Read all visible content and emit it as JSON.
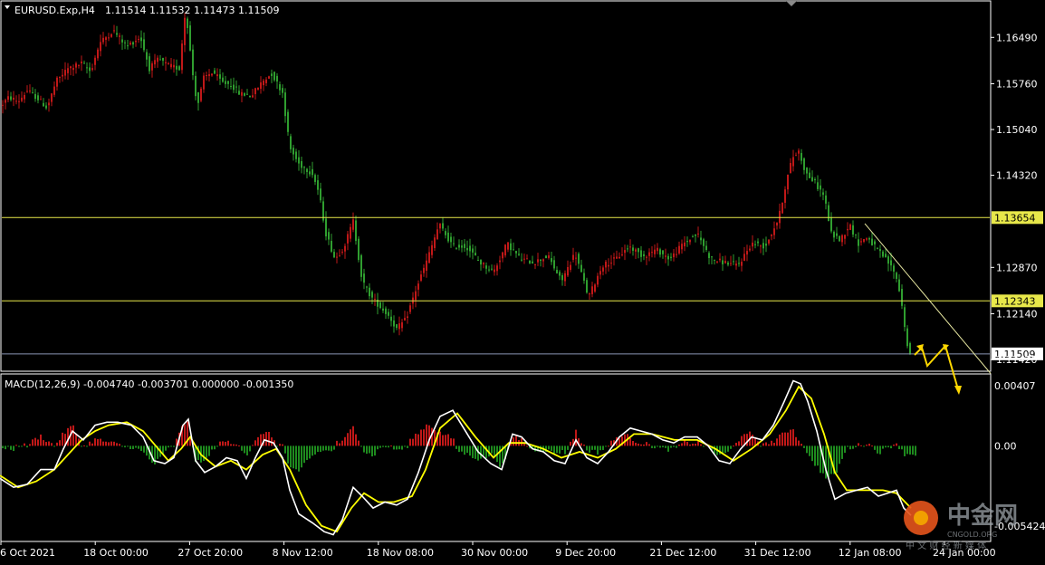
{
  "header": {
    "symbol": "EURUSD.Exp,H4",
    "ohlc": "1.11514 1.11532 1.11473 1.11509"
  },
  "macd": {
    "label": "MACD(12,26,9) -0.004740 -0.003701 0.000000 -0.001350"
  },
  "watermark": {
    "brand": "中金网",
    "sub": "CNGOLD.ORG",
    "tagline": "中 文 财 经 新 媒 体"
  },
  "colors": {
    "background": "#000000",
    "bull_candle": "#c01818",
    "bear_candle": "#2f9e2f",
    "level_line": "#e8e84a",
    "bid_line": "#8a96b4",
    "macd_line": "#ffffff",
    "signal_line": "#ffff00",
    "hist_positive": "#c01818",
    "hist_negative": "#1e8a1e"
  },
  "chart_data": [
    {
      "type": "candlestick",
      "title": "EURUSD.Exp,H4",
      "ylim": [
        1.1125,
        1.1705
      ],
      "ytick_labels": [
        "1.16490",
        "1.15760",
        "1.15040",
        "1.14320",
        "1.12870",
        "1.12140",
        "1.11420"
      ],
      "xtick_labels": [
        "6 Oct 2021",
        "18 Oct 00:00",
        "27 Oct 20:00",
        "8 Nov 12:00",
        "18 Nov 08:00",
        "30 Nov 00:00",
        "9 Dec 20:00",
        "21 Dec 12:00",
        "31 Dec 12:00",
        "12 Jan 08:00",
        "24 Jan 00:00"
      ],
      "price_path": [
        [
          0,
          1.154
        ],
        [
          10,
          1.1555
        ],
        [
          20,
          1.1548
        ],
        [
          30,
          1.1565
        ],
        [
          40,
          1.1555
        ],
        [
          52,
          1.1538
        ],
        [
          62,
          1.158
        ],
        [
          75,
          1.16
        ],
        [
          90,
          1.1608
        ],
        [
          100,
          1.1595
        ],
        [
          110,
          1.164
        ],
        [
          125,
          1.166
        ],
        [
          140,
          1.1635
        ],
        [
          155,
          1.165
        ],
        [
          165,
          1.16
        ],
        [
          175,
          1.1615
        ],
        [
          185,
          1.1605
        ],
        [
          198,
          1.16
        ],
        [
          205,
          1.1695
        ],
        [
          212,
          1.16
        ],
        [
          218,
          1.154
        ],
        [
          225,
          1.1585
        ],
        [
          235,
          1.1595
        ],
        [
          245,
          1.1578
        ],
        [
          255,
          1.1575
        ],
        [
          265,
          1.156
        ],
        [
          278,
          1.1558
        ],
        [
          290,
          1.158
        ],
        [
          300,
          1.1592
        ],
        [
          312,
          1.1562
        ],
        [
          320,
          1.1475
        ],
        [
          330,
          1.145
        ],
        [
          345,
          1.1435
        ],
        [
          352,
          1.1405
        ],
        [
          360,
          1.134
        ],
        [
          370,
          1.13
        ],
        [
          380,
          1.132
        ],
        [
          390,
          1.136
        ],
        [
          400,
          1.1265
        ],
        [
          410,
          1.124
        ],
        [
          420,
          1.1225
        ],
        [
          430,
          1.121
        ],
        [
          438,
          1.119
        ],
        [
          448,
          1.1205
        ],
        [
          460,
          1.1255
        ],
        [
          472,
          1.13
        ],
        [
          485,
          1.1355
        ],
        [
          500,
          1.132
        ],
        [
          515,
          1.132
        ],
        [
          530,
          1.1295
        ],
        [
          545,
          1.128
        ],
        [
          560,
          1.1325
        ],
        [
          575,
          1.13
        ],
        [
          590,
          1.1295
        ],
        [
          605,
          1.1305
        ],
        [
          620,
          1.1265
        ],
        [
          635,
          1.131
        ],
        [
          650,
          1.124
        ],
        [
          665,
          1.129
        ],
        [
          680,
          1.13
        ],
        [
          695,
          1.132
        ],
        [
          710,
          1.1305
        ],
        [
          725,
          1.1315
        ],
        [
          740,
          1.13
        ],
        [
          755,
          1.1325
        ],
        [
          770,
          1.134
        ],
        [
          785,
          1.13
        ],
        [
          800,
          1.1295
        ],
        [
          815,
          1.129
        ],
        [
          830,
          1.1325
        ],
        [
          845,
          1.132
        ],
        [
          860,
          1.1365
        ],
        [
          868,
          1.142
        ],
        [
          875,
          1.146
        ],
        [
          882,
          1.147
        ],
        [
          890,
          1.1435
        ],
        [
          900,
          1.142
        ],
        [
          910,
          1.14
        ],
        [
          918,
          1.134
        ],
        [
          928,
          1.133
        ],
        [
          938,
          1.1355
        ],
        [
          948,
          1.1325
        ],
        [
          958,
          1.1335
        ],
        [
          968,
          1.1315
        ],
        [
          978,
          1.13
        ],
        [
          988,
          1.128
        ],
        [
          995,
          1.124
        ],
        [
          1000,
          1.118
        ],
        [
          1006,
          1.114
        ]
      ],
      "horizontal_levels": [
        {
          "price": 1.13654,
          "label": "1.13654"
        },
        {
          "price": 1.12343,
          "label": "1.12343"
        }
      ],
      "bid_line": {
        "price": 1.11509,
        "label": "1.11509"
      },
      "trendline": [
        [
          955,
          1.1356
        ],
        [
          1094,
          1.112
        ]
      ]
    },
    {
      "type": "macd",
      "title": "MACD(12,26,9)",
      "ylim": [
        -0.0064,
        0.0048
      ],
      "ytick_labels": [
        "0.00407",
        "0.00",
        "-0.005424"
      ],
      "macd_path": [
        [
          0,
          -0.0022
        ],
        [
          15,
          -0.0028
        ],
        [
          30,
          -0.0026
        ],
        [
          45,
          -0.0016
        ],
        [
          60,
          -0.0016
        ],
        [
          70,
          -0.0002
        ],
        [
          80,
          0.001
        ],
        [
          92,
          0.0004
        ],
        [
          105,
          0.0014
        ],
        [
          118,
          0.0016
        ],
        [
          130,
          0.0016
        ],
        [
          145,
          0.0014
        ],
        [
          158,
          0.0006
        ],
        [
          170,
          -0.001
        ],
        [
          182,
          -0.0012
        ],
        [
          192,
          -0.0008
        ],
        [
          202,
          0.0014
        ],
        [
          208,
          0.0018
        ],
        [
          216,
          -0.001
        ],
        [
          226,
          -0.0018
        ],
        [
          238,
          -0.0014
        ],
        [
          250,
          -0.0008
        ],
        [
          262,
          -0.001
        ],
        [
          272,
          -0.0022
        ],
        [
          282,
          -0.0008
        ],
        [
          292,
          0.0004
        ],
        [
          302,
          0.0002
        ],
        [
          312,
          -0.0008
        ],
        [
          320,
          -0.003
        ],
        [
          330,
          -0.0046
        ],
        [
          345,
          -0.0052
        ],
        [
          358,
          -0.0058
        ],
        [
          368,
          -0.006
        ],
        [
          378,
          -0.005
        ],
        [
          390,
          -0.0028
        ],
        [
          400,
          -0.0034
        ],
        [
          412,
          -0.0042
        ],
        [
          425,
          -0.0038
        ],
        [
          438,
          -0.004
        ],
        [
          450,
          -0.0036
        ],
        [
          462,
          -0.0018
        ],
        [
          474,
          0.0004
        ],
        [
          486,
          0.002
        ],
        [
          500,
          0.0024
        ],
        [
          514,
          0.001
        ],
        [
          528,
          -0.0004
        ],
        [
          542,
          -0.0012
        ],
        [
          554,
          -0.0016
        ],
        [
          566,
          0.0008
        ],
        [
          576,
          0.0006
        ],
        [
          588,
          -0.0002
        ],
        [
          600,
          -0.0004
        ],
        [
          612,
          -0.001
        ],
        [
          624,
          -0.0012
        ],
        [
          636,
          0.0004
        ],
        [
          648,
          -0.0008
        ],
        [
          660,
          -0.0012
        ],
        [
          672,
          -0.0004
        ],
        [
          684,
          0.0006
        ],
        [
          696,
          0.0012
        ],
        [
          708,
          0.001
        ],
        [
          720,
          0.0008
        ],
        [
          732,
          0.0004
        ],
        [
          744,
          0.0002
        ],
        [
          756,
          0.0006
        ],
        [
          770,
          0.0006
        ],
        [
          782,
          0.0
        ],
        [
          794,
          -0.001
        ],
        [
          806,
          -0.0012
        ],
        [
          818,
          -0.0002
        ],
        [
          830,
          0.0006
        ],
        [
          842,
          0.0004
        ],
        [
          854,
          0.0014
        ],
        [
          866,
          0.003
        ],
        [
          876,
          0.0044
        ],
        [
          884,
          0.0042
        ],
        [
          892,
          0.003
        ],
        [
          902,
          0.001
        ],
        [
          912,
          -0.0016
        ],
        [
          922,
          -0.0036
        ],
        [
          934,
          -0.0032
        ],
        [
          946,
          -0.003
        ],
        [
          958,
          -0.0028
        ],
        [
          970,
          -0.0034
        ],
        [
          980,
          -0.0032
        ],
        [
          990,
          -0.003
        ],
        [
          998,
          -0.0042
        ],
        [
          1006,
          -0.0047
        ]
      ],
      "signal_path": [
        [
          0,
          -0.002
        ],
        [
          20,
          -0.0028
        ],
        [
          40,
          -0.0024
        ],
        [
          60,
          -0.0016
        ],
        [
          75,
          -0.0006
        ],
        [
          90,
          0.0004
        ],
        [
          105,
          0.001
        ],
        [
          120,
          0.0014
        ],
        [
          140,
          0.0016
        ],
        [
          158,
          0.001
        ],
        [
          172,
          0.0
        ],
        [
          186,
          -0.001
        ],
        [
          200,
          -0.0002
        ],
        [
          210,
          0.0006
        ],
        [
          222,
          -0.0006
        ],
        [
          238,
          -0.0014
        ],
        [
          255,
          -0.001
        ],
        [
          272,
          -0.0016
        ],
        [
          290,
          -0.0006
        ],
        [
          305,
          -0.0002
        ],
        [
          320,
          -0.0016
        ],
        [
          338,
          -0.004
        ],
        [
          355,
          -0.0054
        ],
        [
          372,
          -0.0058
        ],
        [
          388,
          -0.0042
        ],
        [
          402,
          -0.0032
        ],
        [
          418,
          -0.0038
        ],
        [
          435,
          -0.0038
        ],
        [
          455,
          -0.0034
        ],
        [
          470,
          -0.0016
        ],
        [
          486,
          0.0012
        ],
        [
          505,
          0.0022
        ],
        [
          525,
          0.0006
        ],
        [
          545,
          -0.0008
        ],
        [
          562,
          0.0002
        ],
        [
          580,
          0.0002
        ],
        [
          600,
          -0.0002
        ],
        [
          620,
          -0.0008
        ],
        [
          640,
          -0.0004
        ],
        [
          660,
          -0.0008
        ],
        [
          680,
          -0.0002
        ],
        [
          700,
          0.0008
        ],
        [
          720,
          0.0008
        ],
        [
          745,
          0.0004
        ],
        [
          770,
          0.0004
        ],
        [
          790,
          -0.0002
        ],
        [
          810,
          -0.001
        ],
        [
          830,
          -0.0002
        ],
        [
          850,
          0.0008
        ],
        [
          868,
          0.0024
        ],
        [
          882,
          0.004
        ],
        [
          896,
          0.0032
        ],
        [
          910,
          0.0008
        ],
        [
          922,
          -0.0018
        ],
        [
          935,
          -0.003
        ],
        [
          955,
          -0.003
        ],
        [
          975,
          -0.003
        ],
        [
          990,
          -0.0032
        ],
        [
          1006,
          -0.0042
        ]
      ],
      "histogram_note": "red bars above zero, green bars below zero"
    }
  ]
}
